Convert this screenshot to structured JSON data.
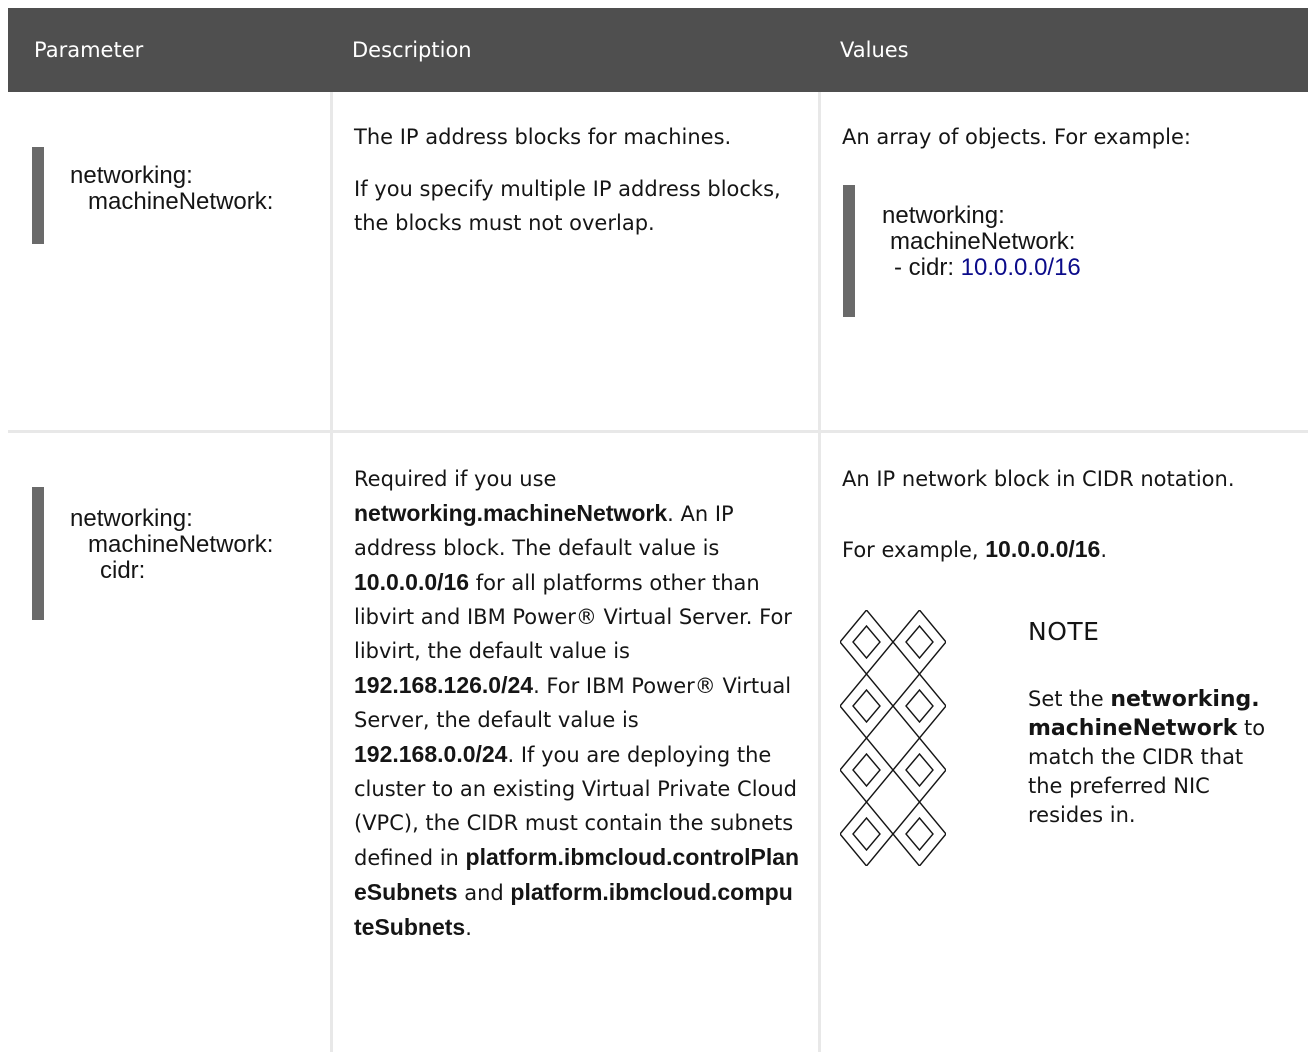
{
  "header": {
    "parameter": "Parameter",
    "description": "Description",
    "values": "Values"
  },
  "rows": [
    {
      "param_lines": [
        "networking:",
        "machineNetwork:"
      ],
      "desc_p1": "The IP address blocks for machines.",
      "desc_p2": "If you specify multiple IP address blocks, the blocks must not overlap.",
      "value_intro": "An array of objects. For example:",
      "code_lines": [
        "networking:",
        "machineNetwork:",
        "- cidr: "
      ],
      "code_cidr": "10.0.0.0/16"
    },
    {
      "param_lines": [
        "networking:",
        "machineNetwork:",
        "cidr:"
      ],
      "desc": {
        "t1": "Required if you use ",
        "b1": "networking.machineNetwork",
        "t2": ". An IP address block. The default value is ",
        "b2": "10.0.0.0/16",
        "t3": " for all platforms other than libvirt and IBM Power® Virtual Server. For libvirt, the default value is ",
        "b3": "192.168.126.0/24",
        "t4": ". For IBM Power® Virtual Server, the default value is ",
        "b4": "192.168.0.0/24",
        "t5": ". If you are deploying the cluster to an existing Virtual Private Cloud (VPC), the CIDR must contain the subnets defined in ",
        "b5": "platform.ibmcloud.controlPlaneSubnets",
        "t6": " and ",
        "b6": "platform.ibmcloud.computeSubnets",
        "t7": "."
      },
      "value_intro": "An IP network block in CIDR notation.",
      "example_prefix": "For example, ",
      "example_value": "10.0.0.0/16",
      "example_suffix": ".",
      "note": {
        "icon": "note-pattern-icon",
        "title": "NOTE",
        "t1": "Set the ",
        "b1": "networking.machineNetwork",
        "t2": " to match the CIDR that the preferred NIC resides in."
      }
    }
  ]
}
